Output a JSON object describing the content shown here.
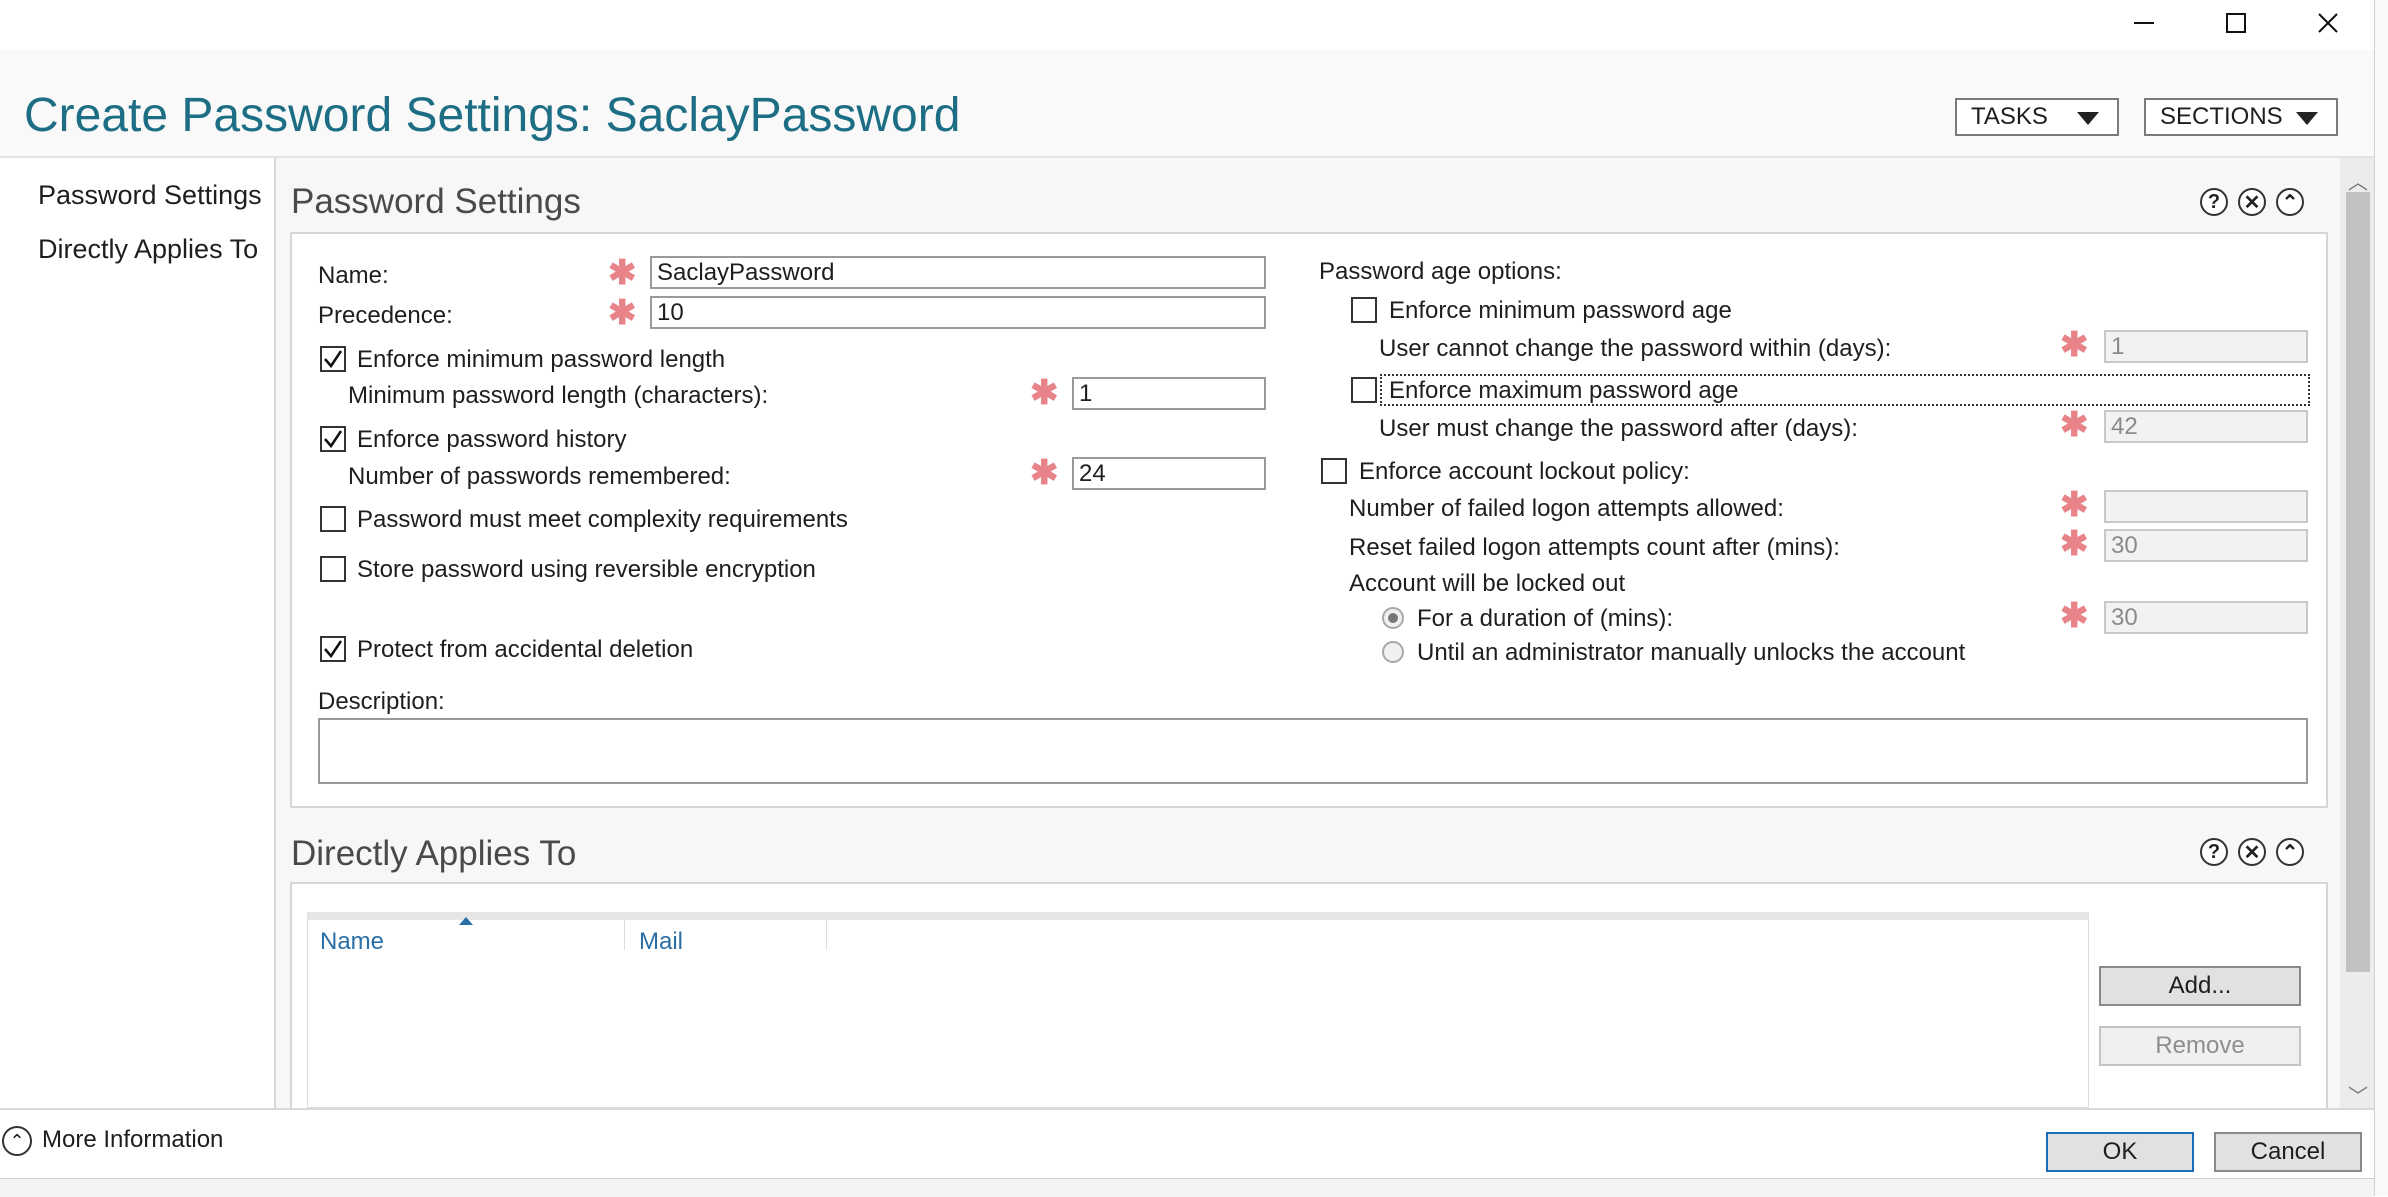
{
  "window": {
    "minimize_icon": "minimize-icon",
    "maximize_icon": "maximize-icon",
    "close_icon": "close-icon"
  },
  "header": {
    "title": "Create Password Settings: SaclayPassword",
    "tasks_label": "TASKS",
    "sections_label": "SECTIONS"
  },
  "nav": {
    "items": [
      "Password Settings",
      "Directly Applies To"
    ]
  },
  "password_settings": {
    "title": "Password Settings",
    "name_label": "Name:",
    "name_value": "SaclayPassword",
    "precedence_label": "Precedence:",
    "precedence_value": "10",
    "enforce_min_length": {
      "label": "Enforce minimum password length",
      "checked": true
    },
    "min_length_label": "Minimum password length (characters):",
    "min_length_value": "1",
    "enforce_history": {
      "label": "Enforce password history",
      "checked": true
    },
    "history_label": "Number of passwords remembered:",
    "history_value": "24",
    "complexity": {
      "label": "Password must meet complexity requirements",
      "checked": false
    },
    "reversible": {
      "label": "Store password using reversible encryption",
      "checked": false
    },
    "protect": {
      "label": "Protect from accidental deletion",
      "checked": true
    },
    "description_label": "Description:",
    "age_options_label": "Password age options:",
    "enforce_min_age": {
      "label": "Enforce minimum password age",
      "checked": false
    },
    "min_age_label": "User cannot change the password within (days):",
    "min_age_value": "1",
    "enforce_max_age": {
      "label": "Enforce maximum password age",
      "checked": false
    },
    "max_age_label": "User must change the password after (days):",
    "max_age_value": "42",
    "lockout": {
      "label": "Enforce account lockout policy:",
      "checked": false
    },
    "failed_attempts_label": "Number of failed logon attempts allowed:",
    "failed_attempts_value": "",
    "reset_label": "Reset failed logon attempts count after (mins):",
    "reset_value": "30",
    "locked_out_label": "Account will be locked out",
    "duration_label": "For a duration of (mins):",
    "duration_value": "30",
    "until_admin_label": "Until an administrator manually unlocks the account"
  },
  "applies_to": {
    "title": "Directly Applies To",
    "columns": [
      "Name",
      "Mail"
    ],
    "add_label": "Add...",
    "remove_label": "Remove"
  },
  "footer": {
    "more_info": "More Information",
    "ok": "OK",
    "cancel": "Cancel"
  },
  "colors": {
    "title": "#1d6e85",
    "required_star": "#e8838a",
    "column_header": "#2a6ea6"
  }
}
